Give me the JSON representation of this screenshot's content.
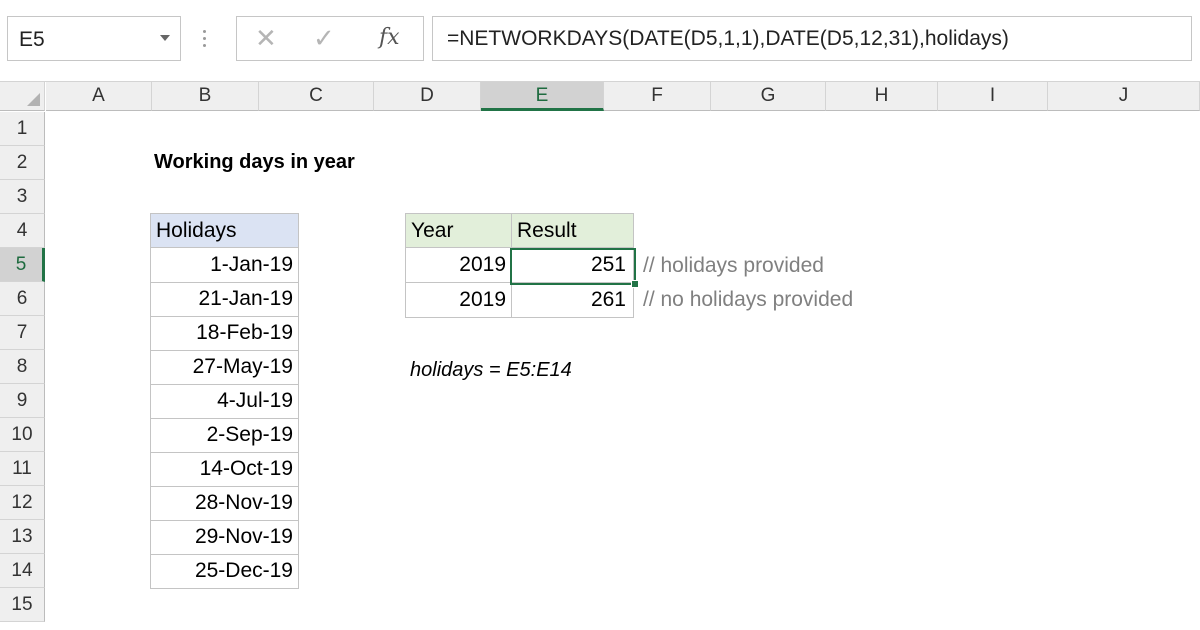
{
  "formula_bar": {
    "name_box": "E5",
    "cancel_icon": "x-icon",
    "enter_icon": "check-icon",
    "function_icon": "fx",
    "formula": "=NETWORKDAYS(DATE(D5,1,1),DATE(D5,12,31),holidays)"
  },
  "columns": [
    "A",
    "B",
    "C",
    "D",
    "E",
    "F",
    "G",
    "H",
    "I",
    "J"
  ],
  "selected_column": "E",
  "rows": [
    "1",
    "2",
    "3",
    "4",
    "5",
    "6",
    "7",
    "8",
    "9",
    "10",
    "11",
    "12",
    "13",
    "14",
    "15"
  ],
  "selected_row": "5",
  "sheet": {
    "title": "Working days in year",
    "holidays_header": "Holidays",
    "holidays": [
      "1-Jan-19",
      "21-Jan-19",
      "18-Feb-19",
      "27-May-19",
      "4-Jul-19",
      "2-Sep-19",
      "14-Oct-19",
      "28-Nov-19",
      "29-Nov-19",
      "25-Dec-19"
    ],
    "results": {
      "year_header": "Year",
      "result_header": "Result",
      "rows": [
        {
          "year": "2019",
          "result": "251",
          "comment": "// holidays provided"
        },
        {
          "year": "2019",
          "result": "261",
          "comment": "// no holidays provided"
        }
      ]
    },
    "named_range": "holidays = E5:E14"
  },
  "colors": {
    "accent": "#217346",
    "holidays_header_fill": "#dbe3f3",
    "results_header_fill": "#e2efda",
    "comment_text": "#808080"
  }
}
